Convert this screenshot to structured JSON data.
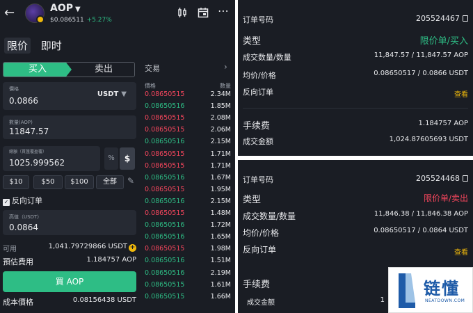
{
  "header": {
    "pair": "AOP",
    "price": "$0.086511",
    "change": "+5.27%"
  },
  "tabs": [
    "限价",
    "即时"
  ],
  "order_form": {
    "buy_label": "买入",
    "sell_label": "卖出",
    "price_label": "價格",
    "price_value": "0.0866",
    "price_unit": "USDT",
    "quantity_label": "數量(AOP)",
    "quantity_value": "11847.57",
    "amount_label": "總額（貫匯覆盈覆）",
    "amount_value": "1025.999562",
    "pct_symbol": "%",
    "usd_symbol": "$",
    "quick_amounts": [
      "$10",
      "$50",
      "$100",
      "全部"
    ],
    "reverse_order_label": "反向订单",
    "high_label": "高值（USDT）",
    "high_value": "0.0864",
    "available_label": "可用",
    "available_value": "1,041.79729866 USDT",
    "est_fee_label": "預估費用",
    "est_fee_value": "1.184757 AOP",
    "buy_button": "買 AOP",
    "cost_price_label": "成本價格",
    "cost_price_value": "0.08156438 USDT"
  },
  "orderbook": {
    "title": "交易",
    "col_price": "價格",
    "col_qty": "數量",
    "rows": [
      {
        "price": "0.08650515",
        "qty": "2.34M",
        "side": "sell"
      },
      {
        "price": "0.08650516",
        "qty": "1.85M",
        "side": "buy"
      },
      {
        "price": "0.08650515",
        "qty": "2.08M",
        "side": "sell"
      },
      {
        "price": "0.08650515",
        "qty": "2.06M",
        "side": "sell"
      },
      {
        "price": "0.08650516",
        "qty": "2.15M",
        "side": "buy"
      },
      {
        "price": "0.08650515",
        "qty": "1.71M",
        "side": "sell"
      },
      {
        "price": "0.08650515",
        "qty": "1.71M",
        "side": "sell"
      },
      {
        "price": "0.08650516",
        "qty": "1.67M",
        "side": "buy"
      },
      {
        "price": "0.08650515",
        "qty": "1.95M",
        "side": "sell"
      },
      {
        "price": "0.08650516",
        "qty": "2.15M",
        "side": "buy"
      },
      {
        "price": "0.08650515",
        "qty": "1.48M",
        "side": "sell"
      },
      {
        "price": "0.08650516",
        "qty": "1.72M",
        "side": "buy"
      },
      {
        "price": "0.08650516",
        "qty": "1.65M",
        "side": "buy"
      },
      {
        "price": "0.08650515",
        "qty": "1.98M",
        "side": "sell"
      },
      {
        "price": "0.08650516",
        "qty": "1.51M",
        "side": "buy"
      },
      {
        "price": "0.08650516",
        "qty": "2.19M",
        "side": "buy"
      },
      {
        "price": "0.08650515",
        "qty": "1.61M",
        "side": "buy"
      },
      {
        "price": "0.08650515",
        "qty": "1.66M",
        "side": "buy"
      }
    ]
  },
  "order1": {
    "order_no_label": "订单号码",
    "order_no": "205524467",
    "type_label": "类型",
    "type_value": "限价单/买入",
    "filled_label": "成交数量/数量",
    "filled_value": "11,847.57 / 11,847.57 AOP",
    "avg_price_label": "均价/价格",
    "avg_price_value": "0.08650517 / 0.0866 USDT",
    "reverse_label": "反向订单",
    "view_link": "查看",
    "fee_label": "手续费",
    "fee_value": "1.184757 AOP",
    "total_label": "成交金额",
    "total_value": "1,024.87605693 USDT"
  },
  "order2": {
    "order_no_label": "订单号码",
    "order_no": "205524468",
    "type_label": "类型",
    "type_value": "限价单/卖出",
    "filled_label": "成交数量/数量",
    "filled_value": "11,846.38 / 11,846.38 AOP",
    "avg_price_label": "均价/价格",
    "avg_price_value": "0.08650517 / 0.0864 USDT",
    "reverse_label": "反向订单",
    "view_link": "查看",
    "fee_label": "手续费",
    "total_label": "成交金额",
    "total_partial": "1"
  },
  "watermark": {
    "text": "链懂",
    "sub": "NEATDOWN.COM"
  },
  "colors": {
    "buy": "#2ebd85",
    "sell": "#f6465d",
    "accent": "#f0b90b",
    "background": "#1a1d24"
  }
}
